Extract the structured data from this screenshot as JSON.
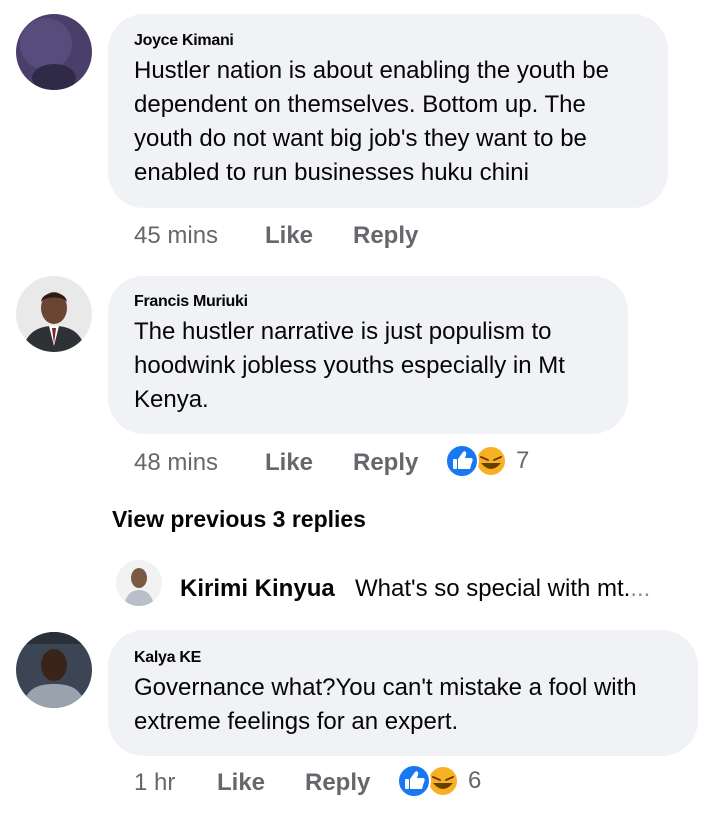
{
  "colors": {
    "bubble": "#f0f2f5",
    "meta_text": "#65676b",
    "like_blue": "#1877f2",
    "haha_yellow": "#f7b125"
  },
  "comments": [
    {
      "author": "Joyce Kimani",
      "lines": [
        "Hustler nation is about enabling the youth be",
        "dependent on themselves. Bottom up. The",
        "youth do not want big job's they want to be",
        "enabled to run businesses huku chini"
      ],
      "time": "45 mins",
      "like_label": "Like",
      "reply_label": "Reply"
    },
    {
      "author": "Francis Muriuki",
      "lines": [
        "The hustler narrative is just populism to",
        "hoodwink jobless youths especially in Mt",
        "Kenya."
      ],
      "time": "48 mins",
      "like_label": "Like",
      "reply_label": "Reply",
      "reactions": {
        "icons": [
          "like-icon",
          "haha-icon"
        ],
        "count": "7"
      }
    },
    {
      "author": "Kalya KE",
      "lines": [
        "Governance what?You can't mistake a fool with",
        "extreme feelings for an expert."
      ],
      "time": "1 hr",
      "like_label": "Like",
      "reply_label": "Reply",
      "reactions": {
        "icons": [
          "like-icon",
          "haha-icon"
        ],
        "count": "6"
      }
    }
  ],
  "replies_link": "View previous 3 replies",
  "reply_preview": {
    "author": "Kirimi Kinyua",
    "text": "What's so special with mt.",
    "ellipsis": "..."
  }
}
